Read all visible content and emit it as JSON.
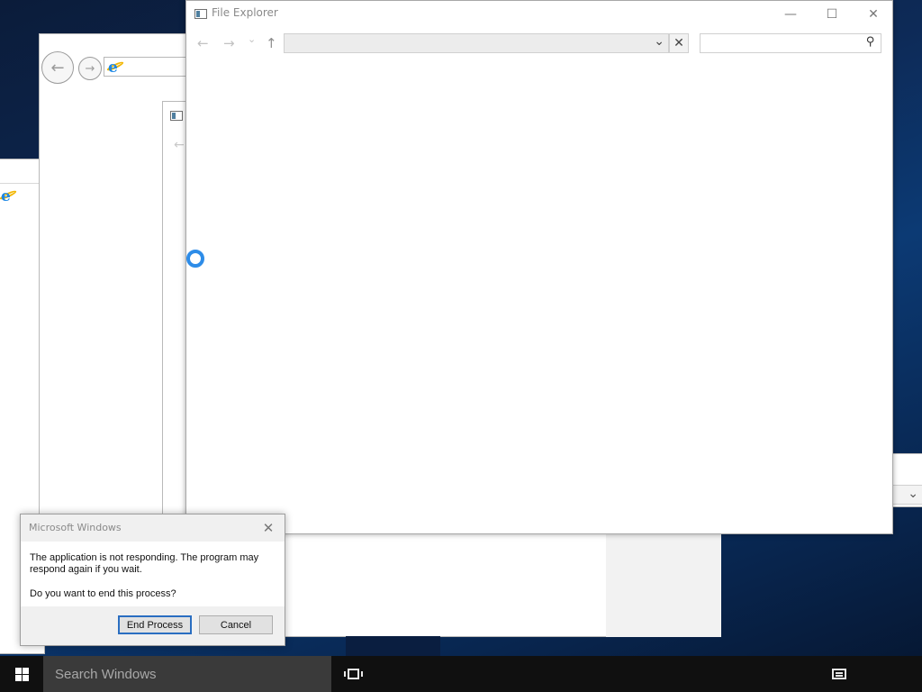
{
  "file_explorer": {
    "title": "File Explorer",
    "address_value": "",
    "search_value": "",
    "minimize_glyph": "—",
    "maximize_glyph": "☐",
    "close_glyph": "✕",
    "back_glyph": "←",
    "forward_glyph": "→",
    "recent_glyph": "⌄",
    "up_glyph": "↑",
    "dropdown_glyph": "⌄",
    "clear_glyph": "✕",
    "search_glyph": "⚲"
  },
  "dialog": {
    "title": "Microsoft Windows",
    "message": "The application is not responding. The program may respond again if you wait.",
    "question": "Do you want to end this process?",
    "end_process_label": "End Process",
    "cancel_label": "Cancel",
    "close_glyph": "✕"
  },
  "taskbar": {
    "search_placeholder": "Search Windows"
  },
  "icons": {
    "ie": "internet-explorer-icon",
    "back": "back-arrow-icon",
    "forward": "forward-arrow-icon",
    "spinner": "busy-spinner-icon"
  },
  "colors": {
    "accent": "#2d8ce8",
    "taskbar": "#101010",
    "dialog_bg": "#f0f0f0"
  }
}
